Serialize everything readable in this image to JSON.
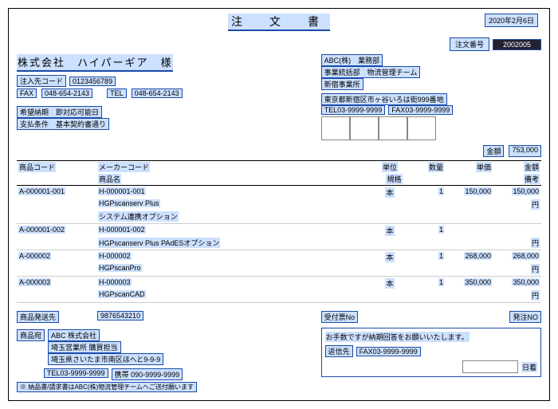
{
  "date": "2020年2月6日",
  "title": "注　文　書",
  "order_no_label": "注文番号",
  "order_no": "2002005",
  "customer": "株式会社　ハイパーギア　様",
  "buyer_code_label": "注入先コード",
  "buyer_code": "0123456789",
  "fax_label": "FAX",
  "fax1": "048-654-2143",
  "tel_label": "TEL",
  "tel1": "048-654-2143",
  "desired_delivery": "希望納期　即対応可能日",
  "payment_terms": "支払条件　基本契約書通り",
  "sender": {
    "company": "ABC(株)　業務部",
    "dept": "事業統括部　物流管理チーム",
    "office": "新宿事業所",
    "address": "東京都新宿区市ヶ谷いろは街999番地",
    "tel_label": "TEL03-9999-9999",
    "fax_label": "FAX03-9999-9999"
  },
  "amount_label": "金額",
  "amount_value": "753,000",
  "headers": {
    "code": "商品コード",
    "maker": "メーカーコード",
    "name": "商品名",
    "std": "規格",
    "unit": "単位",
    "qty": "数量",
    "price": "単価",
    "amt": "金額",
    "note": "備考"
  },
  "items": [
    {
      "code": "A-000001-001",
      "maker": "H-000001-001",
      "name": "HGPscanserv Plus",
      "std": "システム連携オプション",
      "unit": "本",
      "qty": "1",
      "price": "150,000",
      "amt": "150,000",
      "note": "円"
    },
    {
      "code": "A-000001-002",
      "maker": "H-000001-002",
      "name": "HGPscanserv Plus PAdESオプション",
      "std": "",
      "unit": "本",
      "qty": "1",
      "price": "",
      "amt": "",
      "note": "円"
    },
    {
      "code": "A-000002",
      "maker": "H-000002",
      "name": "HGPscanPro",
      "std": "",
      "unit": "本",
      "qty": "1",
      "price": "268,000",
      "amt": "268,000",
      "note": "円"
    },
    {
      "code": "A-000003",
      "maker": "H-000003",
      "name": "HGPscanCAD",
      "std": "",
      "unit": "本",
      "qty": "1",
      "price": "350,000",
      "amt": "350,000",
      "note": "円"
    }
  ],
  "ship": {
    "to_label": "商品発送先",
    "code": "9876543210",
    "goods_label": "商品宛",
    "company": "ABC 株式会社",
    "dept": "埼玉営業所 購買担当",
    "address": "埼玉県さいたま市南区ほへと9-9-9",
    "tel": "TEL03-9999-9999",
    "mobile": "携帯 090-9999-9999",
    "note": "※ 納品書/請求書はABC(株)物流管理チームへご送付願います"
  },
  "receipt": {
    "no_label": "受付票No",
    "order_label": "発注NO"
  },
  "reply": {
    "msg": "お手数ですが納期回答をお願いいたします。",
    "to_label": "返信先",
    "fax": "FAX03-9999-9999",
    "date_suffix": "日着"
  }
}
